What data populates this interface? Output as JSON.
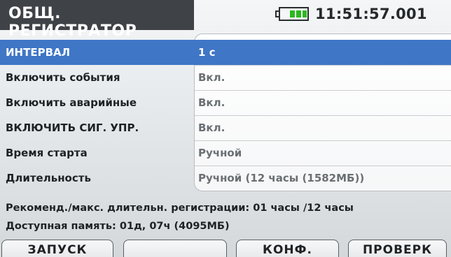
{
  "header": {
    "title": "ОБЩ. РЕГИСТРАТОР",
    "battery_icon": "battery-icon",
    "battery_level": 0.75,
    "clock": "11:51:57.001"
  },
  "settings": [
    {
      "label": "ИНТЕРВАЛ",
      "value": "1 с",
      "selected": true
    },
    {
      "label": "Включить события",
      "value": "Вкл.",
      "selected": false
    },
    {
      "label": "Включить аварийные",
      "value": "Вкл.",
      "selected": false
    },
    {
      "label": "ВКЛЮЧИТЬ СИГ. УПР.",
      "value": "Вкл.",
      "selected": false
    },
    {
      "label": "Время старта",
      "value": "Ручной",
      "selected": false
    },
    {
      "label": "Длительность",
      "value": "Ручной (12 часы  (1582МБ))",
      "selected": false
    }
  ],
  "info": {
    "recommended": "Рекоменд./макс. длительн. регистрации: 01 часы /12 часы",
    "memory": "Доступная память: 01д, 07ч (4095МБ)"
  },
  "function_keys": [
    {
      "label": "ЗАПУСК"
    },
    {
      "label": ""
    },
    {
      "label": "КОНФ."
    },
    {
      "label": "ПРОВЕРК"
    }
  ],
  "colors": {
    "selection": "#3f76c6",
    "title_bg": "#3f4246",
    "battery_fill": "#2bb81d"
  }
}
